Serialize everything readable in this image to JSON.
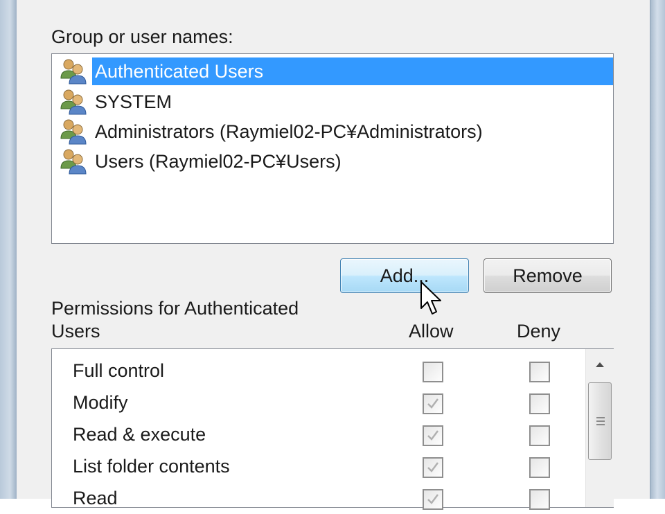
{
  "group_label": "Group or user names:",
  "users": [
    {
      "name": "Authenticated Users",
      "selected": true,
      "icon": "user-group-icon"
    },
    {
      "name": "SYSTEM",
      "selected": false,
      "icon": "user-group-icon"
    },
    {
      "name": "Administrators (Raymiel02-PC¥Administrators)",
      "selected": false,
      "icon": "user-group-icon"
    },
    {
      "name": "Users (Raymiel02-PC¥Users)",
      "selected": false,
      "icon": "user-group-icon"
    }
  ],
  "buttons": {
    "add": "Add...",
    "remove": "Remove"
  },
  "permissions": {
    "label_line1": "Permissions for Authenticated",
    "label_line2": "Users",
    "allow_header": "Allow",
    "deny_header": "Deny",
    "rows": [
      {
        "name": "Full control",
        "allow": "unchecked",
        "deny": "unchecked"
      },
      {
        "name": "Modify",
        "allow": "checked-disabled",
        "deny": "unchecked"
      },
      {
        "name": "Read & execute",
        "allow": "checked-disabled",
        "deny": "unchecked"
      },
      {
        "name": "List folder contents",
        "allow": "checked-disabled",
        "deny": "unchecked"
      },
      {
        "name": "Read",
        "allow": "checked-disabled",
        "deny": "unchecked"
      }
    ]
  },
  "colors": {
    "selection": "#3399ff",
    "button_hover": "#bee6fd"
  }
}
